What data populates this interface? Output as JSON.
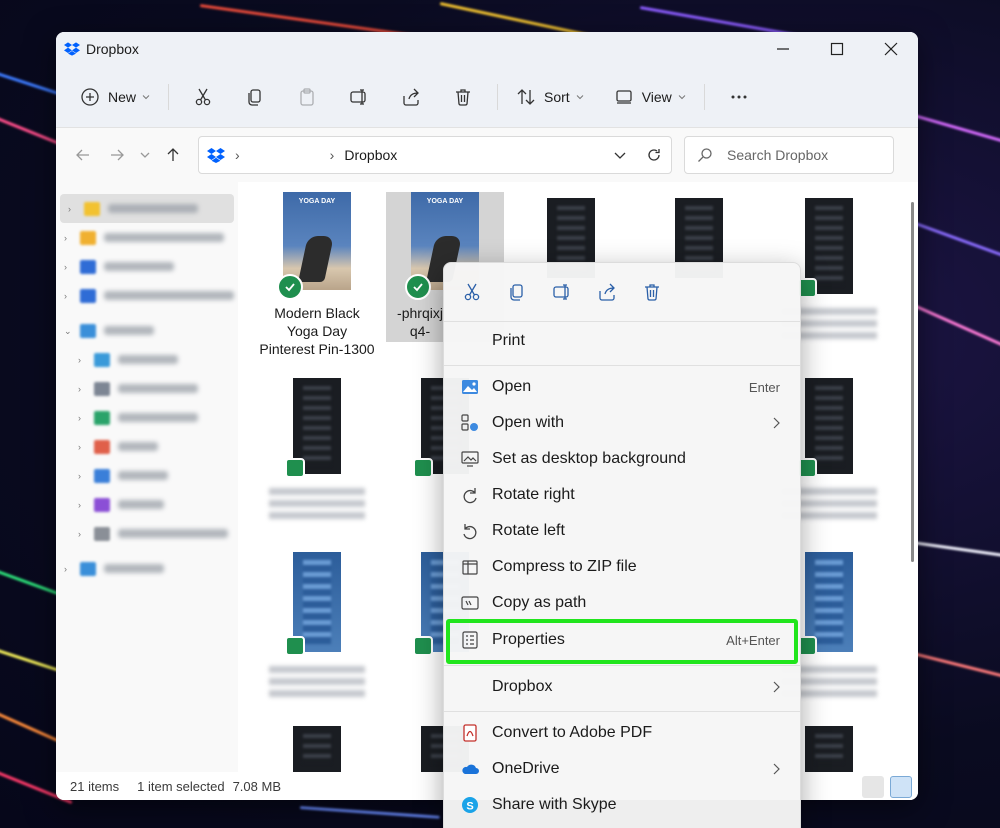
{
  "window": {
    "title": "Dropbox",
    "icon": "dropbox-icon"
  },
  "commandbar": {
    "new_label": "New",
    "sort_label": "Sort",
    "view_label": "View"
  },
  "address": {
    "current_folder": "Dropbox",
    "search_placeholder": "Search Dropbox"
  },
  "files": [
    {
      "label": "Modern Black Yoga Day Pinterest Pin-1300",
      "poster_text": "YOGA DAY",
      "thumb": "poster",
      "status": "synced"
    },
    {
      "label": "-phrqixj q4-",
      "poster_text": "YOGA DAY",
      "thumb": "poster",
      "status": "synced",
      "selected": true
    }
  ],
  "context_menu": {
    "items": [
      {
        "label": "Print",
        "icon": ""
      },
      {
        "label": "Open",
        "icon": "image-icon",
        "shortcut": "Enter"
      },
      {
        "label": "Open with",
        "icon": "open-with-icon",
        "submenu": true
      },
      {
        "label": "Set as desktop background",
        "icon": "desktop-background-icon"
      },
      {
        "label": "Rotate right",
        "icon": "rotate-right-icon"
      },
      {
        "label": "Rotate left",
        "icon": "rotate-left-icon"
      },
      {
        "label": "Compress to ZIP file",
        "icon": "zip-icon"
      },
      {
        "label": "Copy as path",
        "icon": "copy-path-icon"
      },
      {
        "label": "Properties",
        "icon": "properties-icon",
        "shortcut": "Alt+Enter",
        "highlighted": true
      },
      {
        "label": "Dropbox",
        "icon": "",
        "submenu": true
      },
      {
        "label": "Convert to Adobe PDF",
        "icon": "adobe-pdf-icon"
      },
      {
        "label": "OneDrive",
        "icon": "onedrive-icon",
        "submenu": true
      },
      {
        "label": "Share with Skype",
        "icon": "skype-icon"
      }
    ]
  },
  "status": {
    "item_count": "21 items",
    "selection": "1 item selected",
    "size": "7.08 MB"
  },
  "colors": {
    "highlight_border": "#21e51d",
    "sync_green": "#1f8f4e",
    "dropbox_blue": "#0061fe"
  }
}
